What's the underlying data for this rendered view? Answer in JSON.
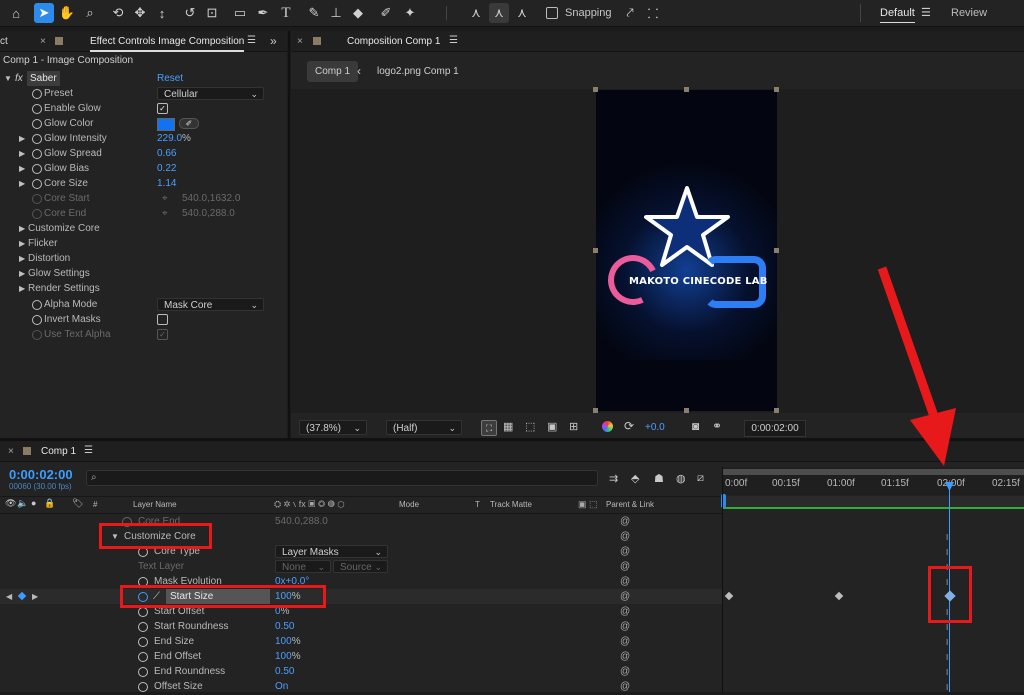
{
  "toolbar": {
    "snapping_label": "Snapping",
    "workspace_default": "Default",
    "workspace_review": "Review"
  },
  "effect_controls": {
    "tab_left": "ct",
    "tab_title": "Effect Controls Image Composition",
    "header": "Comp 1 - Image Composition",
    "effect_name": "Saber",
    "fx_label": "fx",
    "reset": "Reset",
    "props": [
      {
        "label": "Preset",
        "value": "Cellular"
      },
      {
        "label": "Enable Glow",
        "value": "✓"
      },
      {
        "label": "Glow Color",
        "value": ""
      },
      {
        "label": "Glow Intensity",
        "value": "229.0",
        "unit": "%"
      },
      {
        "label": "Glow Spread",
        "value": "0.66"
      },
      {
        "label": "Glow Bias",
        "value": "0.22"
      },
      {
        "label": "Core Size",
        "value": "1.14"
      },
      {
        "label": "Core Start",
        "value": "540.0,1632.0"
      },
      {
        "label": "Core End",
        "value": "540.0,288.0"
      },
      {
        "label": "Customize Core"
      },
      {
        "label": "Flicker"
      },
      {
        "label": "Distortion"
      },
      {
        "label": "Glow Settings"
      },
      {
        "label": "Render Settings"
      },
      {
        "label": "Alpha Mode",
        "value": "Mask Core"
      },
      {
        "label": "Invert Masks"
      },
      {
        "label": "Use Text Alpha"
      }
    ]
  },
  "composition": {
    "tab_title": "Composition Comp 1",
    "breadcrumb_comp": "Comp 1",
    "breadcrumb_sub": "logo2.png Comp 1",
    "logo_text": "MAKOTO CINECODE LAB",
    "zoom": "(37.8%)",
    "resolution": "(Half)",
    "exposure": "+0.0",
    "timecode": "0:00:02:00"
  },
  "timeline": {
    "tab_title": "Comp 1",
    "current_time": "0:00:02:00",
    "frame_info": "00060 (30.00 fps)",
    "search_placeholder": "",
    "col_layer_name": "Layer Name",
    "col_hash": "#",
    "col_mode": "Mode",
    "col_t": "T",
    "col_track_matte": "Track Matte",
    "col_parent": "Parent & Link",
    "ruler": [
      "0:00f",
      "00:15f",
      "01:00f",
      "01:15f",
      "02:00f",
      "02:15f"
    ],
    "rows": [
      {
        "label": "Core End",
        "value": "540.0,288.0"
      },
      {
        "label": "Customize Core"
      },
      {
        "label": "Core Type",
        "value": "Layer Masks"
      },
      {
        "label": "Text Layer",
        "value": "None",
        "value2": "Source"
      },
      {
        "label": "Mask Evolution",
        "value": "0x+0.0°"
      },
      {
        "label": "Start Size",
        "value": "100",
        "unit": "%"
      },
      {
        "label": "Start Offset",
        "value": "0",
        "unit": "%"
      },
      {
        "label": "Start Roundness",
        "value": "0.50"
      },
      {
        "label": "End Size",
        "value": "100",
        "unit": "%"
      },
      {
        "label": "End Offset",
        "value": "100",
        "unit": "%"
      },
      {
        "label": "End Roundness",
        "value": "0.50"
      },
      {
        "label": "Offset Size",
        "value": "On"
      }
    ]
  },
  "colors": {
    "accent": "#2d8ceb",
    "value_blue": "#4a9fff",
    "highlight_red": "#e8191b",
    "work_area_green": "#2fae3b",
    "glow_color_swatch": "#1173f0"
  }
}
